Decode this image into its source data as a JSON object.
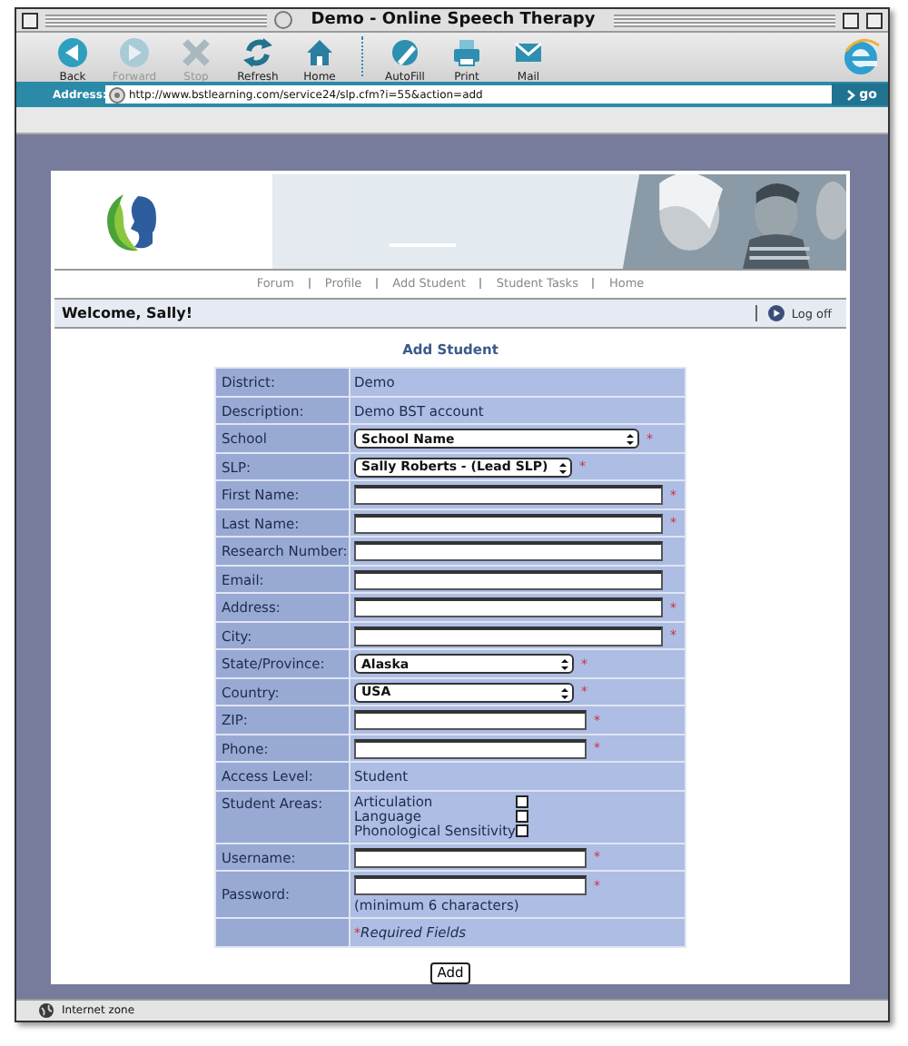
{
  "window": {
    "title": "Demo - Online Speech Therapy"
  },
  "toolbar": {
    "buttons": [
      {
        "label": "Back",
        "disabled": false
      },
      {
        "label": "Forward",
        "disabled": true
      },
      {
        "label": "Stop",
        "disabled": true
      },
      {
        "label": "Refresh",
        "disabled": false
      },
      {
        "label": "Home",
        "disabled": false
      },
      {
        "label": "AutoFill",
        "disabled": false
      },
      {
        "label": "Print",
        "disabled": false
      },
      {
        "label": "Mail",
        "disabled": false
      }
    ]
  },
  "address_bar": {
    "label": "Address:",
    "url": "http://www.bstlearning.com/service24/slp.cfm?i=55&action=add",
    "go": "go"
  },
  "site": {
    "nav": [
      "Forum",
      "Profile",
      "Add Student",
      "Student Tasks",
      "Home"
    ],
    "welcome": "Welcome, Sally!",
    "logoff": "Log off",
    "heading": "Add Student"
  },
  "form": {
    "required_mark": "*",
    "rows": [
      {
        "label": "District:",
        "kind": "text",
        "value": "Demo",
        "required": false
      },
      {
        "label": "Description:",
        "kind": "text",
        "value": "Demo BST account",
        "required": false
      },
      {
        "label": "School",
        "kind": "select",
        "value": "School Name",
        "required": true
      },
      {
        "label": "SLP:",
        "kind": "select",
        "value": "Sally Roberts - (Lead SLP)",
        "required": true
      },
      {
        "label": "First Name:",
        "kind": "input",
        "required": true
      },
      {
        "label": "Last Name:",
        "kind": "input",
        "required": true
      },
      {
        "label": "Research Number:",
        "kind": "input",
        "required": false
      },
      {
        "label": "Email:",
        "kind": "input",
        "required": false
      },
      {
        "label": "Address:",
        "kind": "input",
        "required": true
      },
      {
        "label": "City:",
        "kind": "input",
        "required": true
      },
      {
        "label": "State/Province:",
        "kind": "select",
        "value": "Alaska",
        "required": true
      },
      {
        "label": "Country:",
        "kind": "select",
        "value": "USA",
        "required": true
      },
      {
        "label": "ZIP:",
        "kind": "input",
        "required": true
      },
      {
        "label": "Phone:",
        "kind": "input",
        "required": true
      },
      {
        "label": "Access Level:",
        "kind": "text",
        "value": "Student",
        "required": false
      },
      {
        "label": "Student Areas:",
        "kind": "checkboxes",
        "required": false,
        "items": [
          {
            "label": "Articulation",
            "checked": false
          },
          {
            "label": "Language",
            "checked": false
          },
          {
            "label": "Phonological Sensitivity",
            "checked": false
          }
        ]
      },
      {
        "label": "Username:",
        "kind": "input",
        "required": true
      },
      {
        "label": "Password:",
        "kind": "input",
        "required": true,
        "hint": "(minimum 6 characters)"
      }
    ],
    "note": "Required Fields",
    "submit": "Add"
  },
  "status_bar": {
    "text": "Internet zone"
  }
}
